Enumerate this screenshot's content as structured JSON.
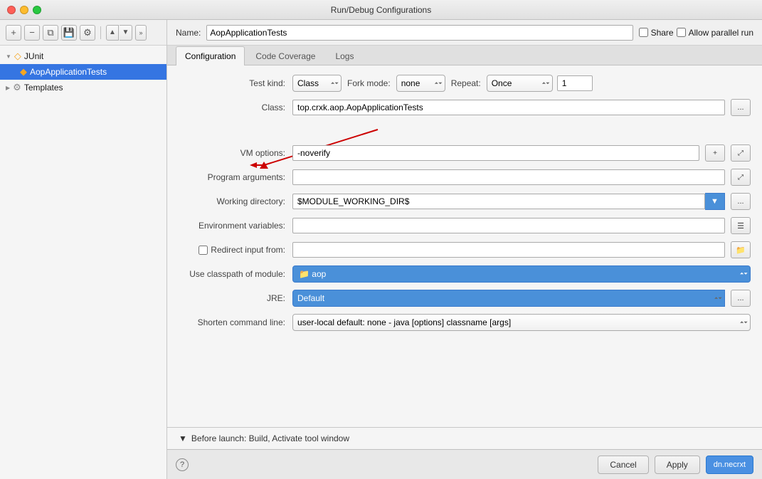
{
  "window": {
    "title": "Run/Debug Configurations"
  },
  "toolbar": {
    "add_label": "+",
    "remove_label": "−",
    "copy_label": "⧉",
    "save_label": "💾",
    "wrench_label": "⚙",
    "arrow_up_label": "▲",
    "arrow_down_label": "▼",
    "more_label": "»"
  },
  "sidebar": {
    "junit_label": "JUnit",
    "junit_icon": "◇",
    "config_label": "AopApplicationTests",
    "config_icon": "◆",
    "templates_label": "Templates",
    "templates_icon": "⚙"
  },
  "header": {
    "name_label": "Name:",
    "name_value": "AopApplicationTests",
    "share_label": "Share",
    "parallel_label": "Allow parallel run"
  },
  "tabs": {
    "items": [
      {
        "id": "configuration",
        "label": "Configuration",
        "active": true
      },
      {
        "id": "code-coverage",
        "label": "Code Coverage",
        "active": false
      },
      {
        "id": "logs",
        "label": "Logs",
        "active": false
      }
    ]
  },
  "form": {
    "test_kind_label": "Test kind:",
    "test_kind_value": "Class",
    "fork_mode_label": "Fork mode:",
    "fork_mode_value": "none",
    "repeat_label": "Repeat:",
    "repeat_value": "Once",
    "repeat_count": "1",
    "class_label": "Class:",
    "class_value": "top.crxk.aop.AopApplicationTests",
    "vm_options_label": "VM options:",
    "vm_options_value": "-noverify",
    "program_args_label": "Program arguments:",
    "program_args_value": "",
    "working_dir_label": "Working directory:",
    "working_dir_value": "$MODULE_WORKING_DIR$",
    "env_vars_label": "Environment variables:",
    "env_vars_value": "",
    "redirect_label": "Redirect input from:",
    "redirect_value": "",
    "classpath_label": "Use classpath of module:",
    "classpath_value": "aop",
    "jre_label": "JRE:",
    "jre_value": "Default",
    "shorten_label": "Shorten command line:",
    "shorten_value": "user-local default: none - java [options] classname [args]"
  },
  "before_launch": {
    "header": "Before launch: Build, Activate tool window",
    "content": "Build"
  },
  "footer": {
    "cancel_label": "Cancel",
    "apply_label": "Apply",
    "ok_label": "dn.necrxt"
  }
}
